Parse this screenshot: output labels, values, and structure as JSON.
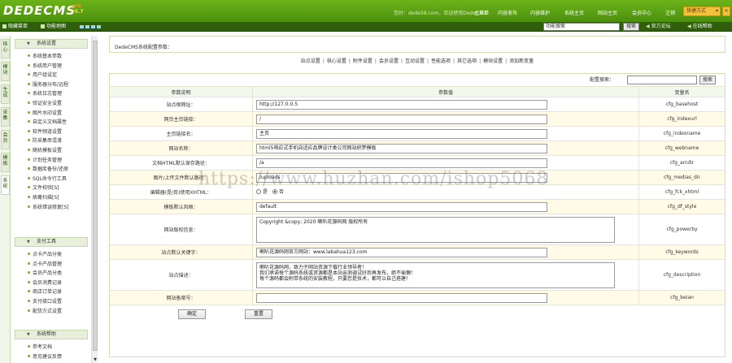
{
  "header": {
    "logo": "DEDECMS",
    "logo_tag": "pro",
    "version": "v5.7",
    "welcome": "您好：dede58.com，欢迎使用DedeCMS！",
    "nav": [
      "主菜单",
      "内容发布",
      "内容维护",
      "系统主页",
      "网站主页",
      "会员中心",
      "注销"
    ],
    "quick_label": "快捷方式",
    "quick_arrow": "▾",
    "close_label": "×"
  },
  "subbar": {
    "hide_menu": "隐藏菜单",
    "function_map": "功能地图",
    "search_value": "功能搜索",
    "search_button": "搜索",
    "forum_link": "官方论坛",
    "help_link": "在线帮助"
  },
  "vtabs": [
    {
      "label": "核心"
    },
    {
      "label": "模块"
    },
    {
      "label": "生成"
    },
    {
      "label": "采集"
    },
    {
      "label": "会员"
    },
    {
      "label": "模板"
    },
    {
      "label": "系统"
    }
  ],
  "sidebar": {
    "sections": [
      {
        "title": "系统设置",
        "items": [
          "系统基本参数",
          "系统用户管理",
          "用户组设定",
          "服务器分布/远程",
          "系统日志管理",
          "验证安全设置",
          "图片水印设置",
          "自定义文档属性",
          "软件频道设置",
          "防采集串混淆",
          "随机模板设置",
          "计划任务管理",
          "数据库备份/还原",
          "SQL命令行工具",
          "文件校验[S]",
          "病毒扫描[S]",
          "系统错误修复[S]"
        ]
      },
      {
        "title": "支付工具",
        "items": [
          "点卡产品分类",
          "点卡产品管理",
          "会员产品分类",
          "会员消费记录",
          "商店订单记录",
          "支付接口设置",
          "配货方式设置"
        ]
      },
      {
        "title": "系统帮助",
        "items": [
          "参考文档",
          "意见建议反馈"
        ]
      }
    ],
    "collapse_icon": "▼",
    "scroll_down": "▼"
  },
  "main": {
    "title": "DedeCMS系统配置参数：",
    "tabs": [
      "站点设置",
      "核心设置",
      "附件设置",
      "会员设置",
      "互动设置",
      "性能选项",
      "其它选项",
      "模块设置",
      "添加新变量"
    ],
    "tab_separator": "|",
    "config_search_label": "配置搜索：",
    "config_search_button": "搜索",
    "columns": [
      "参数说明",
      "参数值",
      "变量名"
    ],
    "rows": [
      {
        "label": "站点根网址：",
        "value": "http://127.0.0.5",
        "var": "cfg_basehost"
      },
      {
        "label": "网页主页链接：",
        "value": "/",
        "var": "cfg_indexurl"
      },
      {
        "label": "主页链接名：",
        "value": "主页",
        "var": "cfg_indexname"
      },
      {
        "label": "网站名称：",
        "value": "html5响应式手机自适应品牌设计类公司网站织梦模板",
        "var": "cfg_webname"
      },
      {
        "label": "文档HTML默认保存路径：",
        "value": "/a",
        "var": "cfg_arcdir"
      },
      {
        "label": "图片/上传文件默认路径：",
        "value": "/uploads",
        "var": "cfg_medias_dir"
      },
      {
        "label": "编辑器(是/否)使用XHTML：",
        "radio_yes": "是",
        "radio_no": "否",
        "var": "cfg_fck_xhtml"
      },
      {
        "label": "模板默认风格：",
        "value": "default",
        "var": "cfg_df_style"
      },
      {
        "label": "网站版权信息：",
        "value": "Copyright &copy; 2020 喇叭花源码网 版权所有",
        "var": "cfg_powerby"
      },
      {
        "label": "站点默认关键字：",
        "value": "喇叭花源码网官方网站：www.labahua123.com",
        "var": "cfg_keywords"
      },
      {
        "label": "站点描述：",
        "value_lines": [
          "喇叭花源码网，致力于网站资源下载行业领导者！",
          "我们承诺每个源码系统或资源都是本站亲测调试好后再发布，绝不偷懒！",
          "每个源码都会附带系统的安装教程，只要您是技术，都可以自己搭建！"
        ],
        "var": "cfg_description"
      },
      {
        "label": "网站备案号：",
        "value": "",
        "var": "cfg_beian"
      }
    ],
    "confirm_button": "确定",
    "reset_button": "重置"
  },
  "watermark": "https://www.huzhan.com/ishop5068"
}
